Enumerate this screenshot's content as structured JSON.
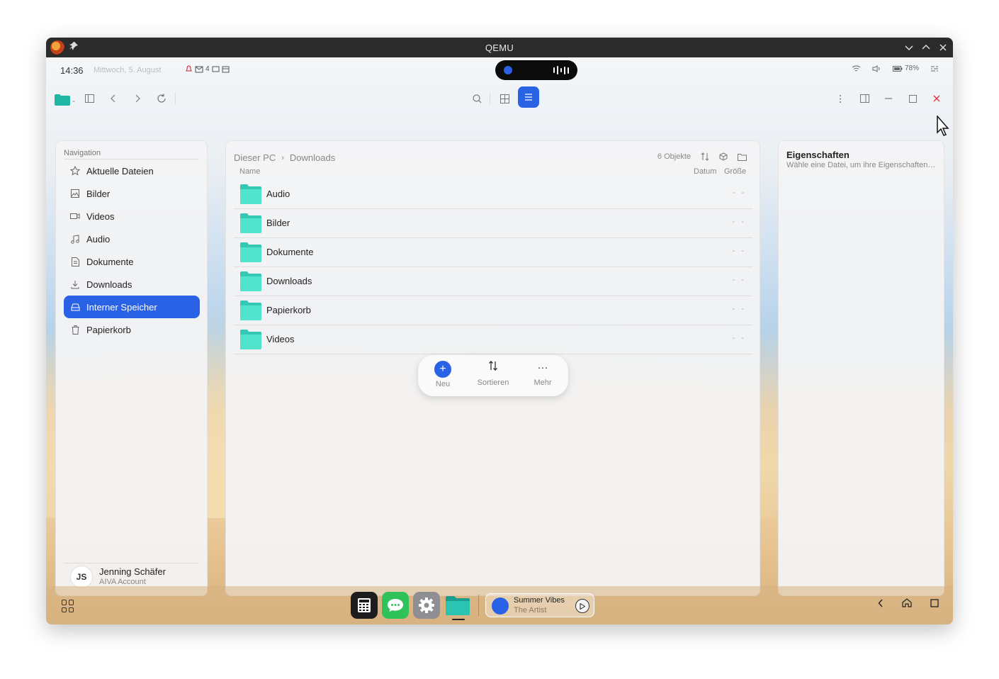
{
  "window": {
    "title": "QEMU"
  },
  "status": {
    "time": "14:36",
    "date": "Mittwoch, 5. August",
    "notif_mail_count": "4",
    "battery": "78%"
  },
  "nav": {
    "title": "Navigation",
    "items": [
      {
        "label": "Aktuelle Dateien",
        "icon": "star-icon"
      },
      {
        "label": "Bilder",
        "icon": "image-icon"
      },
      {
        "label": "Videos",
        "icon": "video-icon"
      },
      {
        "label": "Audio",
        "icon": "music-icon"
      },
      {
        "label": "Dokumente",
        "icon": "document-icon"
      },
      {
        "label": "Downloads",
        "icon": "download-icon"
      },
      {
        "label": "Interner Speicher",
        "icon": "drive-icon",
        "active": true
      },
      {
        "label": "Papierkorb",
        "icon": "trash-icon"
      }
    ],
    "user": {
      "initials": "JS",
      "name": "Jenning Schäfer",
      "account": "AIVA Account"
    }
  },
  "main": {
    "breadcrumb": [
      "Dieser PC",
      "Downloads"
    ],
    "count": "6 Objekte",
    "columns": {
      "name": "Name",
      "date": "Datum",
      "size": "Größe"
    },
    "files": [
      {
        "name": "Audio",
        "date": "-",
        "size": "-"
      },
      {
        "name": "Bilder",
        "date": "-",
        "size": "-"
      },
      {
        "name": "Dokumente",
        "date": "-",
        "size": "-"
      },
      {
        "name": "Downloads",
        "date": "-",
        "size": "-"
      },
      {
        "name": "Papierkorb",
        "date": "-",
        "size": "-"
      },
      {
        "name": "Videos",
        "date": "-",
        "size": "-"
      }
    ],
    "fab": {
      "new": "Neu",
      "sort": "Sortieren",
      "more": "Mehr"
    }
  },
  "props": {
    "title": "Eigenschaften",
    "subtitle": "Wähle eine Datei, um ihre Eigenschaften anzuzeigen"
  },
  "media": {
    "title": "Summer Vibes",
    "artist": "The Artist"
  },
  "colors": {
    "accent": "#2a62e6",
    "folder": "#3fd6c0"
  }
}
